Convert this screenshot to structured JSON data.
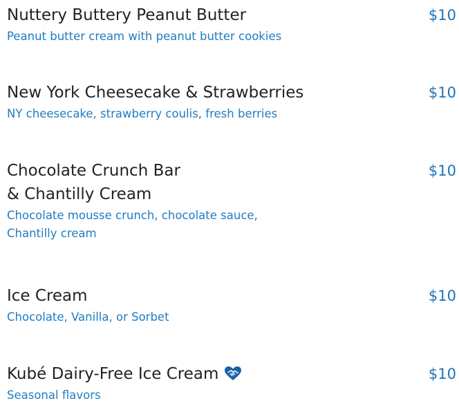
{
  "menu": {
    "items": [
      {
        "name": "Nuttery Buttery Peanut Butter",
        "price": "$10",
        "description": "Peanut butter cream with peanut butter cookies"
      },
      {
        "name": "New York Cheesecake & Strawberries",
        "price": "$10",
        "description": "NY cheesecake, strawberry coulis, fresh berries"
      },
      {
        "name": "Chocolate Crunch Bar\n& Chantilly Cream",
        "price": "$10",
        "description": "Chocolate mousse crunch, chocolate sauce,\nChantilly cream"
      },
      {
        "name": "Ice Cream",
        "price": "$10",
        "description": "Chocolate, Vanilla, or Sorbet"
      },
      {
        "name": "Kubé Dairy-Free Ice Cream",
        "price": "$10",
        "description": "Seasonal flavors",
        "icon": "heart-handshake-icon"
      }
    ]
  },
  "colors": {
    "name_text": "#222222",
    "accent_blue": "#1f7cc2",
    "icon_blue": "#1a5fa8"
  }
}
